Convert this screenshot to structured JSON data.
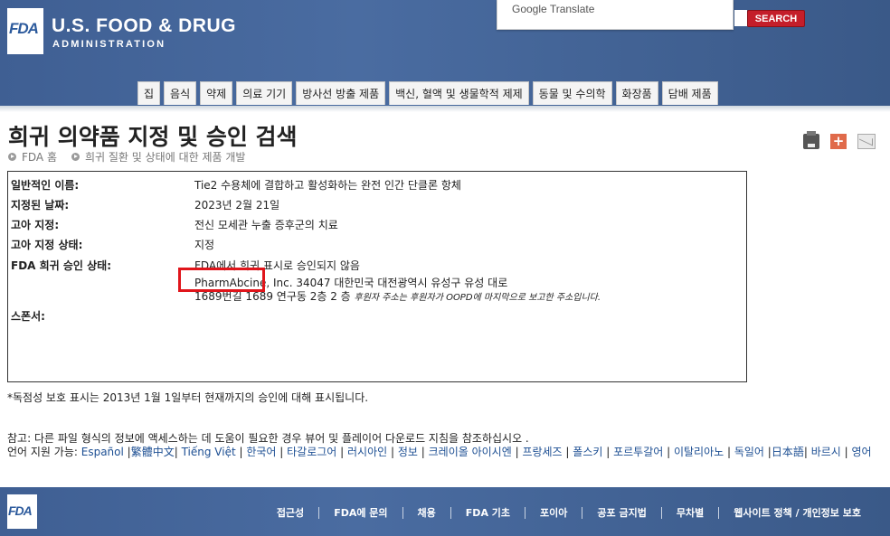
{
  "header": {
    "logo_text": "FDA",
    "agency_line1": "U.S. FOOD & DRUG",
    "agency_line2": "ADMINISTRATION",
    "translate_label": "Google Translate",
    "search_button": "SEARCH"
  },
  "nav": [
    "집",
    "음식",
    "약제",
    "의료 기기",
    "방사선 방출 제품",
    "백신, 혈액 및 생물학적 제제",
    "동물 및 수의학",
    "화장품",
    "담배 제품"
  ],
  "page": {
    "title": "희귀 의약품 지정 및 승인 검색",
    "breadcrumb": [
      "FDA 홈",
      "희귀 질환 및 상태에 대한 제품 개발"
    ]
  },
  "record": {
    "generic_name_label": "일반적인 이름:",
    "generic_name_value": "Tie2 수용체에 결합하고 활성화하는 완전 인간 단클론 항체",
    "designated_date_label": "지정된 날짜:",
    "designated_date_value": "2023년 2월 21일",
    "orphan_designation_label": "고아 지정:",
    "orphan_designation_value": "전신 모세관 누출 증후군의 치료",
    "orphan_status_label": "고아 지정 상태:",
    "orphan_status_value": "지정",
    "approval_status_label": "FDA 희귀 승인 상태:",
    "approval_status_value": "FDA에서 희귀 표시로 승인되지 않음",
    "sponsor_label": "스폰서:",
    "sponsor_line1": "PharmAbcine, Inc. 34047 대한민국 대전광역시 유성구 유성 대로",
    "sponsor_line2": "1689번길 1689 연구동 2층 2 층",
    "sponsor_note": "후원자 주소는 후원자가 OOPD에 마지막으로 보고한 주소입니다."
  },
  "footnote": "*독점성 보호 표시는 2013년 1월 1일부터 현재까지의 승인에 대해 표시됩니다.",
  "note": "참고: 다른 파일 형식의 정보에 액세스하는 데 도움이 필요한 경우 뷰어 및 플레이어 다운로드 지침을 참조하십시오 .",
  "languages": {
    "label": "언어 지원 가능:",
    "links": [
      "Español",
      "繁體中文",
      "Tiếng Việt",
      "한국어",
      "타갈로그어",
      "러시아인",
      "정보",
      "크레이올 아이시엔",
      "프랑세즈",
      "폴스키",
      "포르투갈어",
      "이탈리아노",
      "독일어",
      "日本語",
      "바르시",
      "영어"
    ]
  },
  "footer": {
    "logo_text": "FDA",
    "links": [
      "접근성",
      "FDA에 문의",
      "채용",
      "FDA 기초",
      "포이아",
      "공포 금지법",
      "무차별",
      "웹사이트 정책 / 개인정보 보호"
    ]
  }
}
